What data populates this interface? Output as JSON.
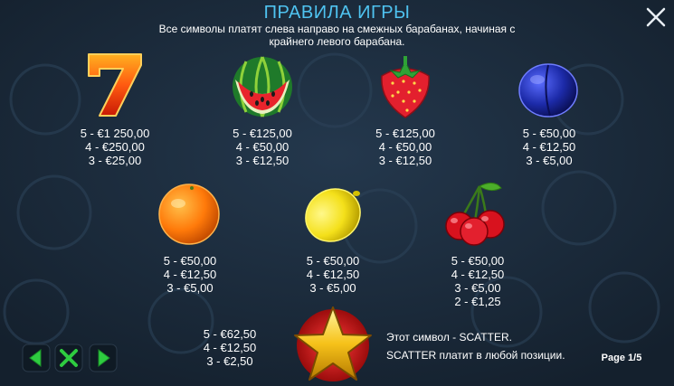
{
  "header": {
    "title": "ПРАВИЛА ИГРЫ",
    "subtitle_line1": "Все символы платят слева направо на смежных барабанах, начиная с",
    "subtitle_line2": "крайнего левого барабана."
  },
  "paytable": {
    "seven": [
      "5 - €1 250,00",
      "4 - €250,00",
      "3 - €25,00"
    ],
    "watermelon": [
      "5 - €125,00",
      "4 - €50,00",
      "3 - €12,50"
    ],
    "strawberry": [
      "5 - €125,00",
      "4 - €50,00",
      "3 - €12,50"
    ],
    "plum": [
      "5 - €50,00",
      "4 - €12,50",
      "3 - €5,00"
    ],
    "orange": [
      "5 - €50,00",
      "4 - €12,50",
      "3 - €5,00"
    ],
    "lemon": [
      "5 - €50,00",
      "4 - €12,50",
      "3 - €5,00"
    ],
    "cherry": [
      "5 - €50,00",
      "4 - €12,50",
      "3 - €5,00",
      "2 - €1,25"
    ],
    "star": [
      "5 - €62,50",
      "4 - €12,50",
      "3 - €2,50"
    ]
  },
  "scatter": {
    "line1": "Этот символ - SCATTER.",
    "line2": "SCATTER платит в любой позиции."
  },
  "footer": {
    "page_label": "Page 1/5"
  },
  "colors": {
    "title": "#4fc3f0",
    "nav_green": "#2ecc40",
    "background": "#1b2a3a"
  },
  "icons": {
    "close": "close-icon",
    "prev": "arrow-left-icon",
    "home": "x-icon",
    "next": "arrow-right-icon"
  }
}
